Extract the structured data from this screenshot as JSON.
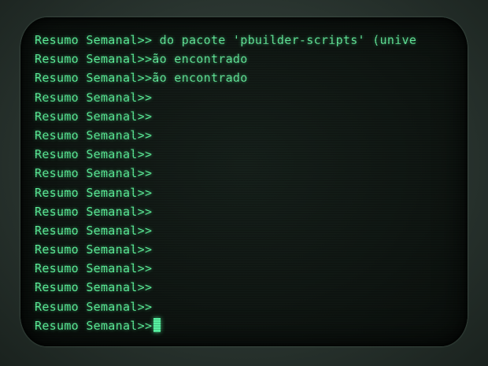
{
  "terminal": {
    "prompt": "Resumo Semanal>>",
    "lines": [
      {
        "text": " do pacote 'pbuilder-scripts' (unive"
      },
      {
        "text": "ão encontrado"
      },
      {
        "text": "ão encontrado"
      },
      {
        "text": ""
      },
      {
        "text": ""
      },
      {
        "text": ""
      },
      {
        "text": ""
      },
      {
        "text": ""
      },
      {
        "text": ""
      },
      {
        "text": ""
      },
      {
        "text": ""
      },
      {
        "text": ""
      },
      {
        "text": ""
      },
      {
        "text": ""
      },
      {
        "text": ""
      },
      {
        "text": ""
      }
    ],
    "ghost_text": ""
  },
  "colors": {
    "phosphor": "#5ef09a",
    "screen": "#0f1612",
    "bezel": "#2a3530"
  }
}
